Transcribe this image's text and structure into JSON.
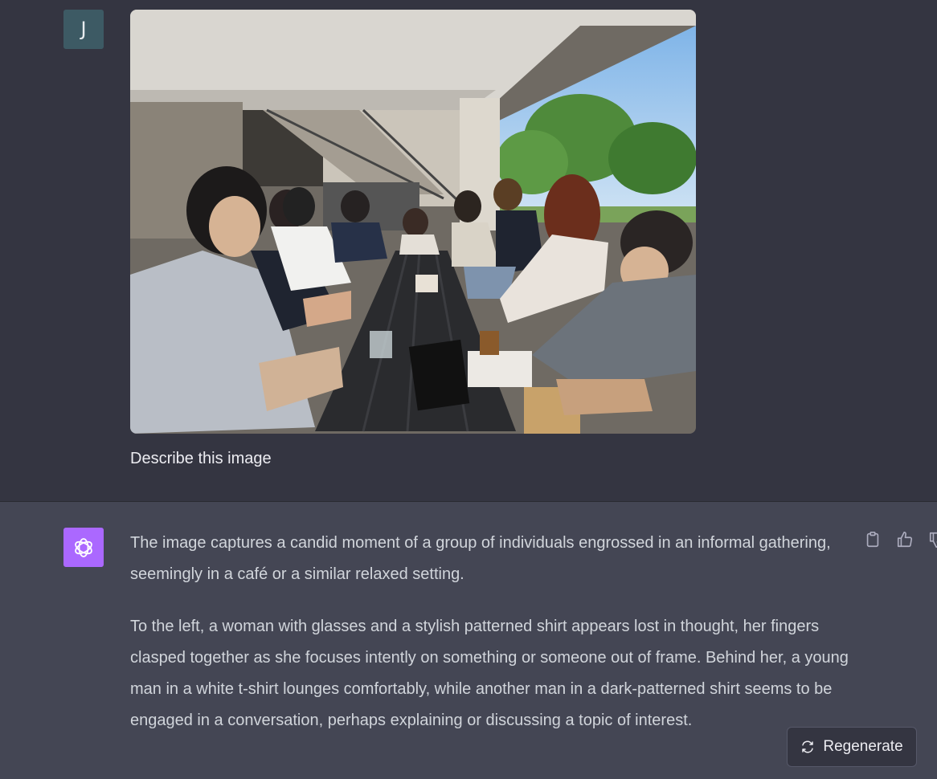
{
  "user": {
    "avatar_letter": "J",
    "prompt_text": "Describe this image"
  },
  "assistant": {
    "paragraphs": [
      "The image captures a candid moment of a group of individuals engrossed in an informal gathering, seemingly in a café or a similar relaxed setting.",
      "To the left, a woman with glasses and a stylish patterned shirt appears lost in thought, her fingers clasped together as she focuses intently on something or someone out of frame. Behind her, a young man in a white t-shirt lounges comfortably, while another man in a dark-patterned shirt seems to be engaged in a conversation, perhaps explaining or discussing a topic of interest."
    ],
    "actions": [
      "copy-icon",
      "thumbs-up-icon",
      "thumbs-down-icon"
    ]
  },
  "regenerate": {
    "label": "Regenerate",
    "icon": "refresh-icon"
  },
  "colors": {
    "user_bg": "#343541",
    "assistant_bg": "#444654",
    "bot_avatar": "#ab68ff",
    "user_avatar": "#3d5a64"
  }
}
